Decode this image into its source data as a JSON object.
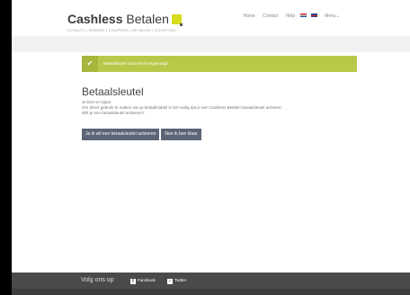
{
  "header": {
    "logo_bold": "Cashless",
    "logo_rest": "Betalen",
    "tagline": "LOYALTY | SPAREN | COUPONS | BETALEN | TICKETING",
    "nav": [
      "Home",
      "Contact",
      "Help"
    ],
    "menu_label": "Menu",
    "menu_chevron": "⌄"
  },
  "alert": {
    "icon": "✔",
    "text": "Betaalsleutel succesvol toegevoegd"
  },
  "main": {
    "title": "Betaalsleutel",
    "line1": "Je bent er bijna!",
    "line2": "Om direct gebruik te maken van je betaalmiddel is het nodig dat je een Cashless Betalen betaalsleutel activeert.",
    "line3": "Wilt je een betaalsleutel activeren?",
    "btn_activate": "Ja ik wil een betaalsleutel activeren",
    "btn_done": "Nee ik ben klaar"
  },
  "footer": {
    "follow": "Volg ons op",
    "facebook": "Facebook",
    "twitter": "Twitter"
  },
  "colors": {
    "accent": "#d7dc1e",
    "alert": "#b8c94a",
    "button": "#5b6575",
    "footer": "#4a4a4a"
  }
}
